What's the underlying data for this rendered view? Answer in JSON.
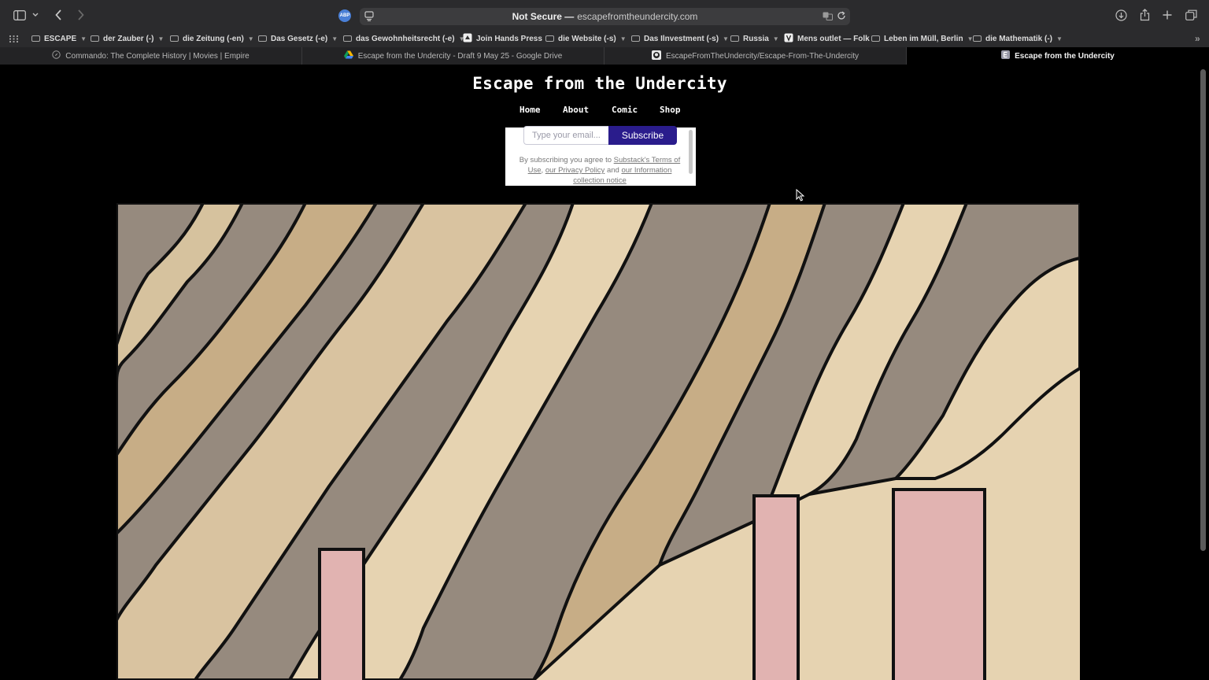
{
  "browser": {
    "url_security": "Not Secure —",
    "url": "escapefromtheundercity.com",
    "abp_label": "ABP"
  },
  "bookmarks": [
    {
      "label": "ESCAPE",
      "type": "folder"
    },
    {
      "label": "der Zauber (-)",
      "type": "folder"
    },
    {
      "label": "die Zeitung (-en)",
      "type": "folder"
    },
    {
      "label": "Das Gesetz (-e)",
      "type": "folder"
    },
    {
      "label": "das Gewohnheitsrecht (-e)",
      "type": "folder"
    },
    {
      "label": "Join Hands Press",
      "type": "link"
    },
    {
      "label": "die Website (-s)",
      "type": "folder"
    },
    {
      "label": "Das Ilnvestment (-s)",
      "type": "folder"
    },
    {
      "label": "Russia",
      "type": "folder"
    },
    {
      "label": "Mens outlet — Folk",
      "type": "link"
    },
    {
      "label": "Leben im Müll, Berlin",
      "type": "folder"
    },
    {
      "label": "die Mathematik (-)",
      "type": "folder"
    }
  ],
  "tabs": [
    {
      "label": "Commando: The Complete History | Movies | Empire",
      "active": false
    },
    {
      "label": "Escape from the Undercity - Draft 9 May 25 - Google Drive",
      "active": false
    },
    {
      "label": "EscapeFromTheUndercity/Escape-From-The-Undercity",
      "active": false
    },
    {
      "label": "Escape from the Undercity",
      "active": true
    }
  ],
  "site": {
    "title": "Escape from the Undercity",
    "nav": [
      "Home",
      "About",
      "Comic",
      "Shop"
    ]
  },
  "subscribe": {
    "placeholder": "Type your email...",
    "button": "Subscribe",
    "terms_prefix": "By subscribing you agree to ",
    "terms_link": "Substack's Terms of Use",
    "sep1": ", ",
    "privacy_link": "our Privacy Policy",
    "sep2": " and ",
    "info_link": "our Information collection notice"
  },
  "colors": {
    "subscribe_button": "#2a1c8c",
    "comic_light": "#e6d3b1",
    "comic_mid": "#c7ad86",
    "comic_grey": "#968a7e",
    "comic_pink": "#e1b3b1"
  }
}
